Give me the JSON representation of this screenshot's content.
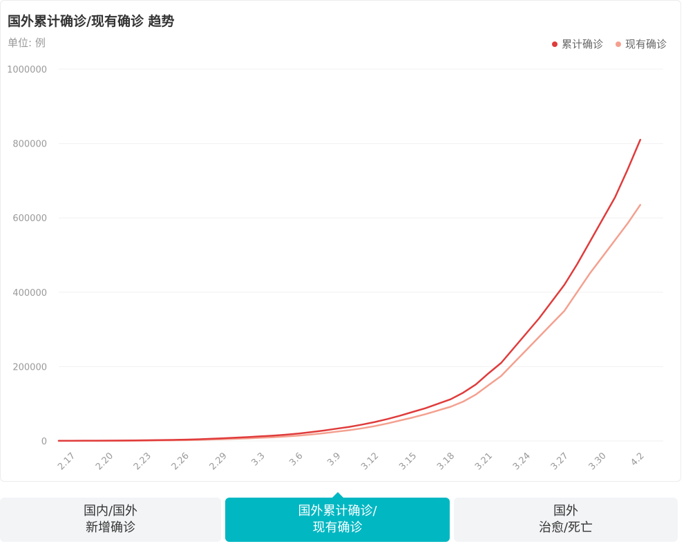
{
  "header": {
    "title": "国外累计确诊/现有确诊 趋势",
    "unit": "单位: 例"
  },
  "legend": [
    {
      "label": "累计确诊",
      "color": "#e03b3b"
    },
    {
      "label": "现有确诊",
      "color": "#f4a08f"
    }
  ],
  "tabs": [
    {
      "line1": "国内/国外",
      "line2": "新增确诊",
      "active": false
    },
    {
      "line1": "国外累计确诊/",
      "line2": "现有确诊",
      "active": true
    },
    {
      "line1": "国外",
      "line2": "治愈/死亡",
      "active": false
    }
  ],
  "chart_data": {
    "type": "line",
    "title": "国外累计确诊/现有确诊 趋势",
    "ylabel": "单位: 例",
    "ylim": [
      0,
      1000000
    ],
    "yticks": [
      0,
      200000,
      400000,
      600000,
      800000,
      1000000
    ],
    "xtick_labels": [
      "2.17",
      "2.20",
      "2.23",
      "2.26",
      "2.29",
      "3.3",
      "3.6",
      "3.9",
      "3.12",
      "3.15",
      "3.18",
      "3.21",
      "3.24",
      "3.27",
      "3.30",
      "4.2"
    ],
    "grid": true,
    "legend_position": "top-right",
    "x": [
      "2.16",
      "2.17",
      "2.18",
      "2.19",
      "2.20",
      "2.21",
      "2.22",
      "2.23",
      "2.24",
      "2.25",
      "2.26",
      "2.27",
      "2.28",
      "2.29",
      "3.1",
      "3.2",
      "3.3",
      "3.4",
      "3.5",
      "3.6",
      "3.7",
      "3.8",
      "3.9",
      "3.10",
      "3.11",
      "3.12",
      "3.13",
      "3.14",
      "3.15",
      "3.16",
      "3.17",
      "3.18",
      "3.19",
      "3.20",
      "3.21",
      "3.22",
      "3.23",
      "3.24",
      "3.25",
      "3.26",
      "3.27",
      "3.28",
      "3.29",
      "3.30",
      "3.31",
      "4.1",
      "4.2"
    ],
    "series": [
      {
        "name": "累计确诊",
        "color": "#e03b3b",
        "values": [
          500,
          600,
          700,
          800,
          900,
          1100,
          1400,
          1800,
          2300,
          2800,
          3500,
          4500,
          5800,
          7200,
          8800,
          10500,
          12500,
          14500,
          17000,
          20000,
          24000,
          28000,
          33000,
          38000,
          44000,
          51000,
          59000,
          68000,
          78000,
          88000,
          100000,
          112000,
          130000,
          152000,
          182000,
          210000,
          250000,
          290000,
          330000,
          375000,
          420000,
          475000,
          535000,
          595000,
          655000,
          730000,
          810000
        ]
      },
      {
        "name": "现有确诊",
        "color": "#f4a08f",
        "values": [
          300,
          350,
          400,
          450,
          500,
          600,
          800,
          1000,
          1300,
          1600,
          2100,
          2800,
          3700,
          4700,
          5800,
          7000,
          8500,
          10000,
          12000,
          14500,
          17500,
          21000,
          25000,
          29000,
          34000,
          40000,
          47000,
          55000,
          63000,
          72000,
          82000,
          92000,
          106000,
          125000,
          150000,
          175000,
          210000,
          245000,
          280000,
          315000,
          350000,
          400000,
          450000,
          495000,
          540000,
          585000,
          635000
        ]
      }
    ]
  }
}
